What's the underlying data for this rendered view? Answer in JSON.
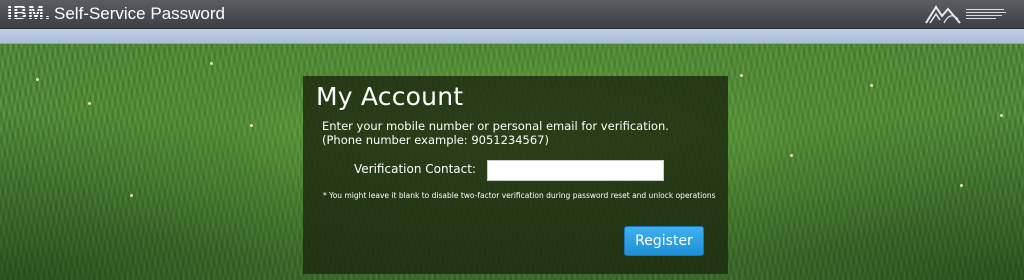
{
  "header": {
    "logo_text": "IBM.",
    "app_title": "Self-Service Password",
    "partner_logo": "organization-logo"
  },
  "account": {
    "title": "My Account",
    "description_line1": "Enter your mobile number or personal email for verification.",
    "description_line2": "(Phone number example: 9051234567)",
    "contact_label": "Verification Contact:",
    "contact_value": "",
    "note": "* You might leave it blank to disable two-factor verification during password reset and unlock operations",
    "register_label": "Register"
  },
  "colors": {
    "topbar": "#46494e",
    "subbar": "#b5c7df",
    "panel": "#1c2810",
    "button": "#2a9ee3"
  }
}
